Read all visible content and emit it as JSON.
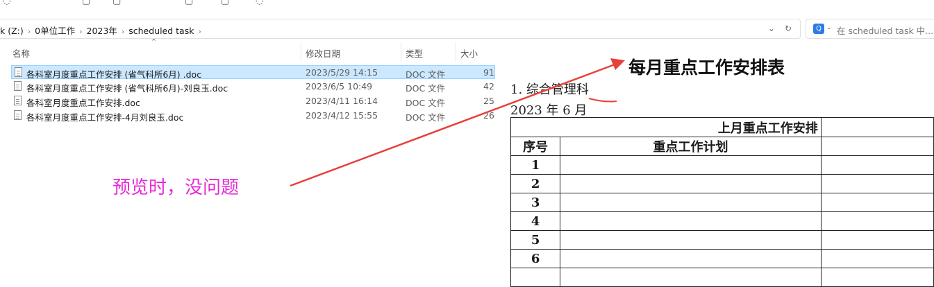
{
  "address_bar": {
    "crumbs": [
      "k (Z:)",
      "0单位工作",
      "2023年",
      "scheduled task"
    ],
    "dropdown_glyph": "⌄",
    "refresh_glyph": "↻"
  },
  "search": {
    "placeholder": "在 scheduled task 中..."
  },
  "columns": {
    "name": "名称",
    "modified": "修改日期",
    "type": "类型",
    "size": "大小"
  },
  "files": [
    {
      "name": "各科室月度重点工作安排 (省气科所6月) .doc",
      "modified": "2023/5/29 14:15",
      "type": "DOC 文件",
      "size": "91",
      "selected": true
    },
    {
      "name": "各科室月度重点工作安排 (省气科所6月)-刘良玉.doc",
      "modified": "2023/6/5 10:49",
      "type": "DOC 文件",
      "size": "42",
      "selected": false
    },
    {
      "name": "各科室月度重点工作安排.doc",
      "modified": "2023/4/11 16:14",
      "type": "DOC 文件",
      "size": "25",
      "selected": false
    },
    {
      "name": "各科室月度重点工作安排-4月刘良玉.doc",
      "modified": "2023/4/12 15:55",
      "type": "DOC 文件",
      "size": "26",
      "selected": false
    }
  ],
  "preview": {
    "title": "每月重点工作安排表",
    "line1": "1. 综合管理科",
    "line2": "2023 年 6 月",
    "table_header": "上月重点工作安排",
    "col_seq": "序号",
    "col_plan": "重点工作计划",
    "rows": [
      "1",
      "2",
      "3",
      "4",
      "5",
      "6",
      ""
    ]
  },
  "annotation": {
    "text": "预览时，没问题",
    "color": "#e62ad7",
    "arrow_color": "#e8403a"
  },
  "colors": {
    "selection_bg": "#cce8ff",
    "selection_border": "#99d1ff",
    "search_accent": "#2d7be5"
  }
}
